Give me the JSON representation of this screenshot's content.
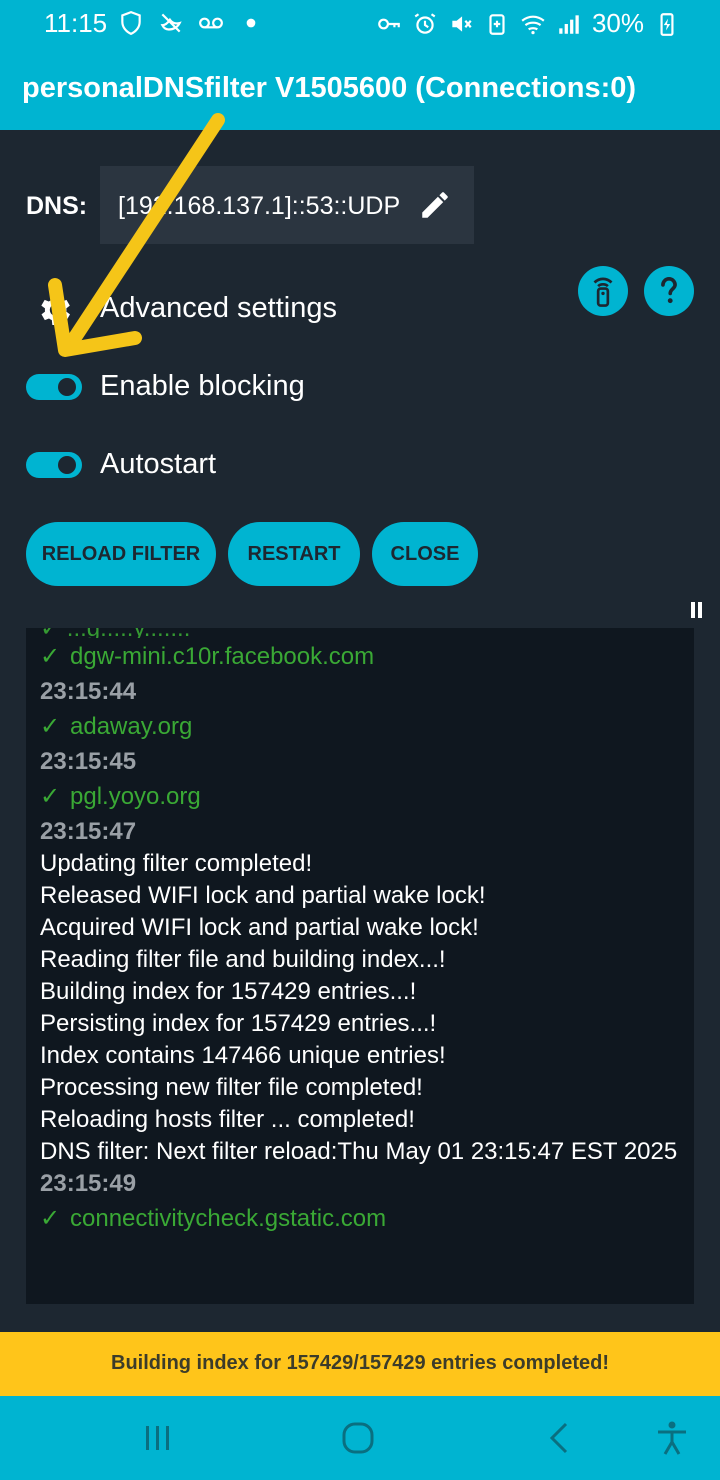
{
  "status_bar": {
    "time": "11:15",
    "battery_percent": "30%",
    "left_icons": [
      "shield-icon",
      "no-bird-icon",
      "voicemail-icon",
      "dot-icon"
    ],
    "right_icons": [
      "key-icon",
      "alarm-icon",
      "mute-icon",
      "battery-saver-icon",
      "wifi-icon",
      "signal-icon",
      "battery-charging-icon"
    ]
  },
  "app_bar": {
    "title": "personalDNSfilter V1505600 (Connections:0)"
  },
  "dns": {
    "label": "DNS:",
    "value": "[192.168.137.1]::53::UDP"
  },
  "settings": {
    "advanced_label": "Advanced settings",
    "enable_blocking_label": "Enable blocking",
    "enable_blocking_on": true,
    "autostart_label": "Autostart",
    "autostart_on": true
  },
  "buttons": {
    "reload_filter": "RELOAD FILTER",
    "restart": "RESTART",
    "close": "CLOSE"
  },
  "log_partial_top": "✓ ...g.....y.......",
  "log": [
    {
      "type": "ok",
      "text": "dgw-mini.c10r.facebook.com"
    },
    {
      "type": "ts",
      "text": "23:15:44"
    },
    {
      "type": "ok",
      "text": "adaway.org"
    },
    {
      "type": "ts",
      "text": "23:15:45"
    },
    {
      "type": "ok",
      "text": "pgl.yoyo.org"
    },
    {
      "type": "ts",
      "text": "23:15:47"
    },
    {
      "type": "msg",
      "text": "Updating filter completed!"
    },
    {
      "type": "msg",
      "text": "Released WIFI lock and partial wake lock!"
    },
    {
      "type": "msg",
      "text": "Acquired WIFI lock and partial wake lock!"
    },
    {
      "type": "msg",
      "text": "Reading filter file and building index...!"
    },
    {
      "type": "msg",
      "text": "Building index for 157429 entries...!"
    },
    {
      "type": "msg",
      "text": "Persisting index for 157429 entries...!"
    },
    {
      "type": "msg",
      "text": "Index contains 147466 unique entries!"
    },
    {
      "type": "msg",
      "text": "Processing new filter file completed!"
    },
    {
      "type": "msg",
      "text": "Reloading hosts filter ... completed!"
    },
    {
      "type": "msg",
      "text": "DNS filter: Next filter reload:Thu May 01 23:15:47 EST 2025"
    },
    {
      "type": "ts",
      "text": "23:15:49"
    },
    {
      "type": "ok",
      "text": "connectivitycheck.gstatic.com"
    }
  ],
  "log_check_glyph": "✓",
  "bottom_status": "Building index for 157429/157429 entries completed!",
  "colors": {
    "accent": "#00b4d1",
    "background": "#1d2731",
    "log_background": "#0f171f",
    "ok_green": "#3aa935",
    "banner_yellow": "#ffc51a",
    "annotation_arrow": "#f5c518"
  }
}
